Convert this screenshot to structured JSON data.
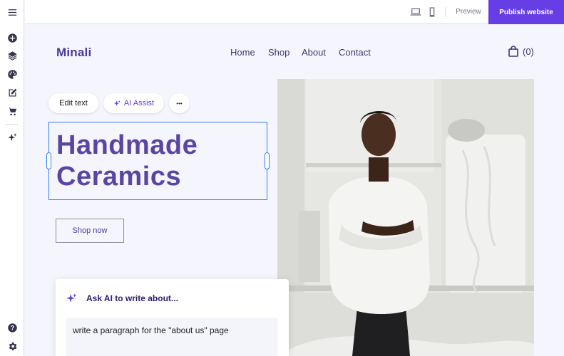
{
  "topbar": {
    "devices": [
      "desktop-icon",
      "mobile-icon"
    ],
    "preview_label": "Preview",
    "publish_label": "Publish website",
    "accent": "#673de6"
  },
  "sidebar": {
    "items": [
      "menu-icon",
      "add-icon",
      "layers-icon",
      "palette-icon",
      "edit-icon",
      "cart-icon",
      "ai-sparkle-icon",
      "help-icon",
      "settings-icon"
    ]
  },
  "site": {
    "logo": "Minali",
    "nav": [
      "Home",
      "Shop",
      "About",
      "Contact"
    ],
    "cart_count": "(0)",
    "heading_line1": "Handmade",
    "heading_line2": "Ceramics",
    "shop_button": "Shop now",
    "heading_color": "#5a45a3"
  },
  "toolbar": {
    "edit_text": "Edit text",
    "ai_assist": "AI Assist",
    "more": "•••"
  },
  "ai_panel": {
    "title": "Ask AI to write about...",
    "input_value": "write a paragraph for the \"about us\" page"
  }
}
